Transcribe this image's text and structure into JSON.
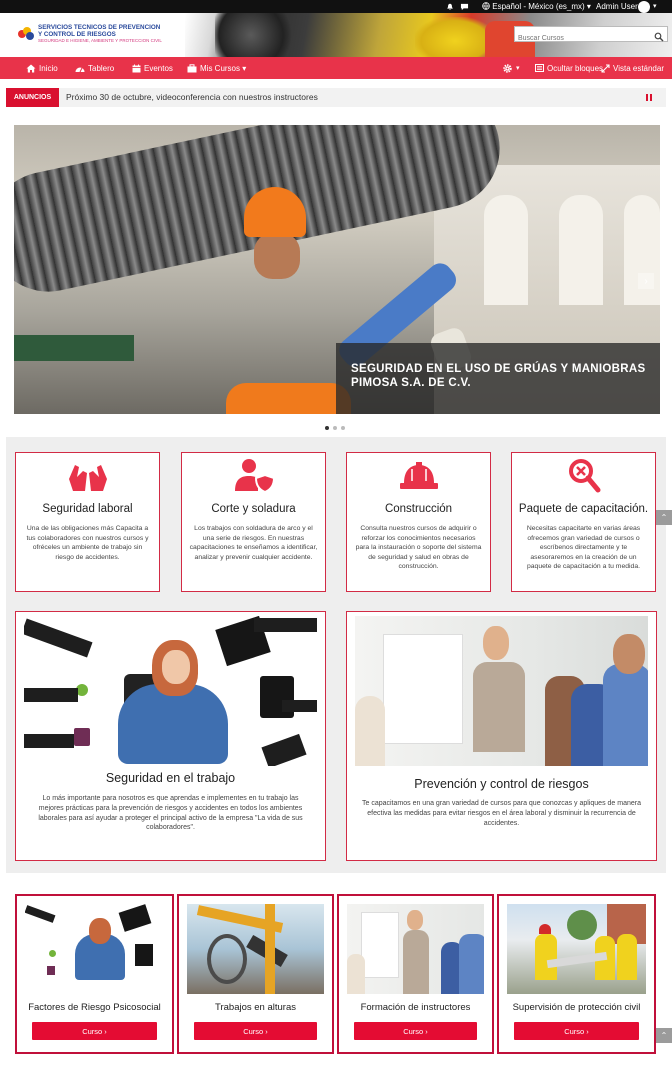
{
  "topbar": {
    "language": "Español - México (es_mx) ▾",
    "user": "Admin User",
    "bell_icon": "bell-icon",
    "chat_icon": "chat-icon",
    "globe_icon": "globe-icon"
  },
  "header": {
    "logo_line1": "SERVICIOS TECNICOS DE PREVENCION",
    "logo_line2": "Y CONTROL DE RIESGOS",
    "logo_line3": "SEGURIDAD E HIGIENE, AMBIENTE Y PROTECCION CIVIL",
    "search_placeholder": "Buscar Cursos"
  },
  "nav": {
    "items": [
      {
        "label": "Inicio",
        "icon": "home-icon"
      },
      {
        "label": "Tablero",
        "icon": "dashboard-icon"
      },
      {
        "label": "Eventos",
        "icon": "calendar-icon"
      },
      {
        "label": "Mis Cursos ▾",
        "icon": "courses-icon"
      }
    ],
    "settings_icon": "gear-icon",
    "hide_blocks": "Ocultar bloques",
    "standard_view": "Vista estándar"
  },
  "announcements": {
    "label": "ANUNCIOS",
    "text": "Próximo 30 de octubre, videoconferencia con nuestros instructores"
  },
  "slider": {
    "caption_line1": "SEGURIDAD EN EL USO DE GRÚAS Y MANIOBRAS",
    "caption_line2": "PIMOSA S.A. DE C.V.",
    "next_arrow": "›"
  },
  "features": [
    {
      "icon": "hands-icon",
      "title": "Seguridad laboral",
      "desc": "Una de las obligaciones más Capacita a tus colaboradores con nuestros cursos y ofréceles un ambiente de trabajo sin riesgo de accidentes."
    },
    {
      "icon": "user-shield-icon",
      "title": "Corte y soladura",
      "desc": "Los trabajos con soldadura de arco y el una serie de riesgos. En nuestras capacitaciones te enseñamos a identificar, analizar y prevenir cualquier accidente."
    },
    {
      "icon": "hard-hat-icon",
      "title": "Construcción",
      "desc": "Consulta nuestros cursos de adquirir o reforzar los conocimientos necesarios para la instauración o soporte del sistema de seguridad y salud en obras de construcción."
    },
    {
      "icon": "search-tools-icon",
      "title": "Paquete de capacitación.",
      "desc": "Necesitas capacitarte en varias áreas ofrecemos gran variedad de cursos o escríbenos directamente y te asesoraremos en la creación de un paquete de capacitación a tu medida."
    }
  ],
  "big_cards": [
    {
      "title": "Seguridad en el trabajo",
      "desc": "Lo más importante para nosotros es que aprendas e implementes en tu trabajo las mejores prácticas para la prevención de riesgos y accidentes en todos los ambientes laborales para así ayudar a proteger el principal activo de la empresa \"La vida de sus colaboradores\"."
    },
    {
      "title": "Prevención y control de riesgos",
      "desc": "Te capacitamos en una gran variedad de cursos para que conozcas y apliques de manera efectiva las medidas para evitar riesgos en el área laboral y disminuir la recurrencia de accidentes."
    }
  ],
  "courses": [
    {
      "title": "Factores de Riesgo Psicosocial",
      "button": "Curso ›"
    },
    {
      "title": "Trabajos en alturas",
      "button": "Curso ›"
    },
    {
      "title": "Formación de instructores",
      "button": "Curso ›"
    },
    {
      "title": "Supervisión de protección civil",
      "button": "Curso ›"
    }
  ],
  "scroll_top": "⌃",
  "colors": {
    "brand_red": "#e8334a",
    "accent_red": "#d9102f",
    "button_red": "#e40c33",
    "card_border": "#d22b45"
  }
}
